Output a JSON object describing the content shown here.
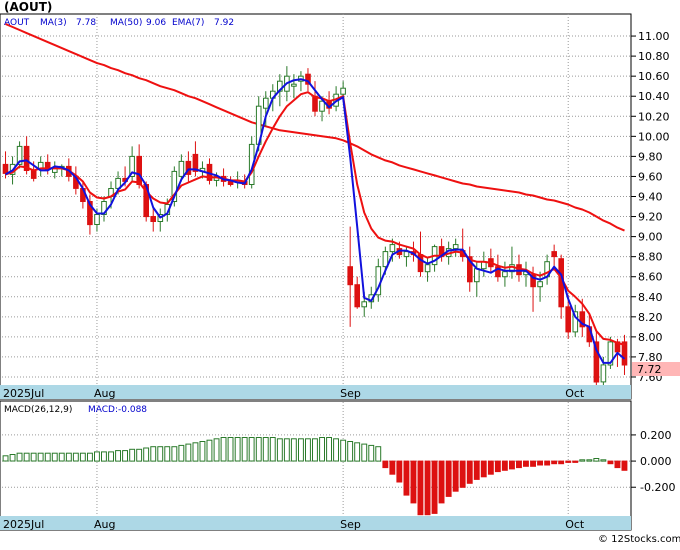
{
  "header": {
    "title": "(AOUT)"
  },
  "watermark": "© 12Stocks.com",
  "colors": {
    "up": "#2a7a2a",
    "down": "#dd1111",
    "ma3": "#1111dd",
    "ema": "#ee1111",
    "ma50": "#ee1111",
    "macd_pos": "#2a7a2a",
    "macd_neg": "#dd1111",
    "axis_band": "#add8e6",
    "price_tag": "#ffb6b6",
    "grid": "#9a9a9a"
  },
  "chart_data": [
    {
      "type": "candlestick",
      "legend": {
        "ticker": "AOUT",
        "ma3_label": "MA(3)",
        "ma3_value": "7.78",
        "ma50_label": "MA(50)",
        "ma50_value": "9.06",
        "ema7_label": "EMA(7)",
        "ema7_value": "7.92"
      },
      "last_price": "7.72",
      "x_tick_labels": [
        "2025Jul",
        "Aug",
        "Sep",
        "Oct"
      ],
      "y_tick_labels": [
        "11.00",
        "10.80",
        "10.60",
        "10.40",
        "10.20",
        "10.00",
        "9.80",
        "9.60",
        "9.40",
        "9.20",
        "9.00",
        "8.80",
        "8.60",
        "8.40",
        "8.20",
        "8.00",
        "7.80",
        "7.60"
      ],
      "ylim": [
        7.52,
        11.22
      ],
      "grid": true,
      "candles": [
        [
          9.72,
          9.85,
          9.58,
          9.63
        ],
        [
          9.62,
          9.8,
          9.52,
          9.72
        ],
        [
          9.72,
          9.95,
          9.68,
          9.9
        ],
        [
          9.9,
          10.0,
          9.62,
          9.66
        ],
        [
          9.66,
          9.75,
          9.55,
          9.58
        ],
        [
          9.68,
          9.8,
          9.6,
          9.74
        ],
        [
          9.74,
          9.82,
          9.62,
          9.67
        ],
        [
          9.64,
          9.75,
          9.58,
          9.68
        ],
        [
          9.68,
          9.72,
          9.6,
          9.7
        ],
        [
          9.7,
          9.78,
          9.55,
          9.6
        ],
        [
          9.6,
          9.7,
          9.42,
          9.48
        ],
        [
          9.48,
          9.55,
          9.28,
          9.35
        ],
        [
          9.35,
          9.42,
          9.02,
          9.12
        ],
        [
          9.12,
          9.28,
          9.05,
          9.22
        ],
        [
          9.22,
          9.4,
          9.15,
          9.35
        ],
        [
          9.4,
          9.55,
          9.28,
          9.48
        ],
        [
          9.48,
          9.65,
          9.42,
          9.58
        ],
        [
          9.58,
          9.7,
          9.5,
          9.55
        ],
        [
          9.6,
          9.9,
          9.55,
          9.8
        ],
        [
          9.8,
          9.92,
          9.48,
          9.52
        ],
        [
          9.52,
          9.55,
          9.15,
          9.2
        ],
        [
          9.2,
          9.28,
          9.05,
          9.15
        ],
        [
          9.15,
          9.28,
          9.05,
          9.22
        ],
        [
          9.22,
          9.38,
          9.15,
          9.32
        ],
        [
          9.35,
          9.7,
          9.3,
          9.65
        ],
        [
          9.6,
          9.82,
          9.55,
          9.75
        ],
        [
          9.75,
          9.85,
          9.55,
          9.62
        ],
        [
          9.82,
          9.95,
          9.6,
          9.65
        ],
        [
          9.65,
          9.75,
          9.58,
          9.68
        ],
        [
          9.72,
          9.78,
          9.52,
          9.56
        ],
        [
          9.56,
          9.64,
          9.5,
          9.6
        ],
        [
          9.6,
          9.68,
          9.5,
          9.55
        ],
        [
          9.55,
          9.6,
          9.5,
          9.52
        ],
        [
          9.54,
          9.65,
          9.48,
          9.56
        ],
        [
          9.55,
          9.62,
          9.48,
          9.52
        ],
        [
          9.52,
          10.0,
          9.48,
          9.92
        ],
        [
          9.92,
          10.4,
          9.85,
          10.3
        ],
        [
          10.28,
          10.45,
          10.1,
          10.38
        ],
        [
          10.38,
          10.52,
          10.25,
          10.45
        ],
        [
          10.45,
          10.62,
          10.3,
          10.55
        ],
        [
          10.45,
          10.7,
          10.35,
          10.6
        ],
        [
          10.5,
          10.62,
          10.38,
          10.52
        ],
        [
          10.55,
          10.65,
          10.45,
          10.6
        ],
        [
          10.62,
          10.68,
          10.45,
          10.52
        ],
        [
          10.4,
          10.55,
          10.2,
          10.25
        ],
        [
          10.25,
          10.4,
          10.15,
          10.35
        ],
        [
          10.35,
          10.45,
          10.22,
          10.28
        ],
        [
          10.3,
          10.5,
          10.25,
          10.42
        ],
        [
          10.42,
          10.55,
          10.35,
          10.48
        ],
        [
          8.7,
          9.1,
          8.1,
          8.52
        ],
        [
          8.52,
          8.6,
          8.28,
          8.3
        ],
        [
          8.3,
          8.45,
          8.2,
          8.35
        ],
        [
          8.35,
          8.5,
          8.28,
          8.42
        ],
        [
          8.42,
          8.78,
          8.35,
          8.7
        ],
        [
          8.7,
          8.9,
          8.62,
          8.85
        ],
        [
          8.85,
          8.98,
          8.75,
          8.92
        ],
        [
          8.88,
          8.95,
          8.78,
          8.82
        ],
        [
          8.8,
          8.9,
          8.7,
          8.85
        ],
        [
          8.85,
          8.95,
          8.75,
          8.82
        ],
        [
          8.82,
          9.05,
          8.6,
          8.65
        ],
        [
          8.65,
          8.8,
          8.55,
          8.72
        ],
        [
          8.72,
          8.92,
          8.65,
          8.9
        ],
        [
          8.9,
          8.98,
          8.75,
          8.8
        ],
        [
          8.8,
          8.95,
          8.72,
          8.88
        ],
        [
          8.88,
          8.98,
          8.8,
          8.92
        ],
        [
          8.86,
          9.08,
          8.75,
          8.8
        ],
        [
          8.8,
          8.9,
          8.45,
          8.55
        ],
        [
          8.55,
          8.75,
          8.4,
          8.68
        ],
        [
          8.68,
          8.85,
          8.6,
          8.75
        ],
        [
          8.78,
          8.88,
          8.65,
          8.7
        ],
        [
          8.7,
          8.82,
          8.55,
          8.6
        ],
        [
          8.6,
          8.75,
          8.5,
          8.65
        ],
        [
          8.65,
          8.9,
          8.58,
          8.72
        ],
        [
          8.72,
          8.82,
          8.55,
          8.62
        ],
        [
          8.62,
          8.75,
          8.5,
          8.65
        ],
        [
          8.62,
          8.7,
          8.25,
          8.5
        ],
        [
          8.5,
          8.65,
          8.35,
          8.55
        ],
        [
          8.6,
          8.82,
          8.52,
          8.75
        ],
        [
          8.85,
          8.92,
          8.7,
          8.8
        ],
        [
          8.78,
          8.82,
          8.18,
          8.3
        ],
        [
          8.3,
          8.42,
          7.98,
          8.05
        ],
        [
          8.05,
          8.32,
          8.0,
          8.25
        ],
        [
          8.25,
          8.38,
          8.0,
          8.1
        ],
        [
          8.1,
          8.22,
          7.9,
          7.95
        ],
        [
          7.95,
          8.05,
          7.52,
          7.55
        ],
        [
          7.55,
          7.8,
          7.52,
          7.72
        ],
        [
          7.72,
          8.0,
          7.68,
          7.95
        ],
        [
          7.95,
          7.98,
          7.7,
          7.85
        ],
        [
          7.95,
          8.02,
          7.62,
          7.72
        ]
      ],
      "ma3": [
        9.62,
        9.66,
        9.75,
        9.76,
        9.71,
        9.66,
        9.66,
        9.7,
        9.69,
        9.66,
        9.59,
        9.48,
        9.32,
        9.23,
        9.23,
        9.32,
        9.47,
        9.54,
        9.64,
        9.62,
        9.51,
        9.29,
        9.19,
        9.23,
        9.4,
        9.57,
        9.67,
        9.67,
        9.65,
        9.63,
        9.61,
        9.57,
        9.56,
        9.54,
        9.53,
        9.67,
        9.91,
        10.2,
        10.38,
        10.46,
        10.53,
        10.56,
        10.57,
        10.55,
        10.46,
        10.37,
        10.29,
        10.35,
        10.39,
        9.79,
        9.1,
        8.39,
        8.36,
        8.49,
        8.66,
        8.82,
        8.86,
        8.86,
        8.83,
        8.77,
        8.73,
        8.76,
        8.81,
        8.86,
        8.87,
        8.87,
        8.76,
        8.68,
        8.66,
        8.64,
        8.68,
        8.66,
        8.66,
        8.66,
        8.66,
        8.59,
        8.57,
        8.6,
        8.7,
        8.62,
        8.38,
        8.2,
        8.13,
        8.1,
        7.87,
        7.74,
        7.74,
        7.84,
        7.78
      ],
      "ema7": [
        9.62,
        9.64,
        9.7,
        9.69,
        9.66,
        9.68,
        9.68,
        9.68,
        9.68,
        9.66,
        9.61,
        9.55,
        9.44,
        9.39,
        9.38,
        9.4,
        9.45,
        9.47,
        9.55,
        9.54,
        9.45,
        9.38,
        9.34,
        9.33,
        9.42,
        9.51,
        9.54,
        9.57,
        9.6,
        9.59,
        9.59,
        9.58,
        9.56,
        9.56,
        9.55,
        9.64,
        9.8,
        9.95,
        10.08,
        10.2,
        10.3,
        10.36,
        10.42,
        10.44,
        10.39,
        10.38,
        10.35,
        10.37,
        10.4,
        9.93,
        9.52,
        9.24,
        9.08,
        8.99,
        8.96,
        8.95,
        8.92,
        8.9,
        8.88,
        8.82,
        8.79,
        8.81,
        8.81,
        8.83,
        8.85,
        8.84,
        8.77,
        8.75,
        8.75,
        8.74,
        8.71,
        8.69,
        8.7,
        8.68,
        8.67,
        8.63,
        8.61,
        8.64,
        8.68,
        8.59,
        8.46,
        8.4,
        8.33,
        8.23,
        8.06,
        7.98,
        7.97,
        7.94,
        7.92
      ],
      "ma50": [
        11.12,
        11.09,
        11.06,
        11.03,
        11.0,
        10.97,
        10.94,
        10.91,
        10.88,
        10.85,
        10.82,
        10.79,
        10.76,
        10.73,
        10.71,
        10.68,
        10.66,
        10.63,
        10.61,
        10.58,
        10.56,
        10.53,
        10.5,
        10.48,
        10.46,
        10.43,
        10.4,
        10.38,
        10.35,
        10.32,
        10.29,
        10.26,
        10.23,
        10.2,
        10.17,
        10.14,
        10.12,
        10.1,
        10.08,
        10.06,
        10.05,
        10.04,
        10.03,
        10.02,
        10.01,
        10.0,
        9.99,
        9.98,
        9.96,
        9.93,
        9.9,
        9.86,
        9.82,
        9.79,
        9.76,
        9.74,
        9.71,
        9.69,
        9.67,
        9.65,
        9.63,
        9.61,
        9.59,
        9.57,
        9.55,
        9.53,
        9.52,
        9.5,
        9.49,
        9.48,
        9.47,
        9.46,
        9.45,
        9.44,
        9.42,
        9.41,
        9.39,
        9.37,
        9.36,
        9.34,
        9.32,
        9.29,
        9.27,
        9.24,
        9.2,
        9.16,
        9.13,
        9.09,
        9.06
      ]
    },
    {
      "type": "bar",
      "legend": {
        "label": "MACD(26,12,9)",
        "value_label": "MACD:-0.088"
      },
      "y_tick_labels": [
        "0.200",
        "0.000",
        "-0.200"
      ],
      "ylim": [
        -0.42,
        0.36
      ],
      "values": [
        0.04,
        0.05,
        0.06,
        0.06,
        0.06,
        0.06,
        0.06,
        0.06,
        0.06,
        0.06,
        0.06,
        0.06,
        0.06,
        0.07,
        0.07,
        0.07,
        0.08,
        0.08,
        0.09,
        0.09,
        0.1,
        0.11,
        0.11,
        0.11,
        0.11,
        0.12,
        0.13,
        0.14,
        0.15,
        0.16,
        0.17,
        0.18,
        0.18,
        0.18,
        0.18,
        0.18,
        0.18,
        0.18,
        0.18,
        0.17,
        0.17,
        0.17,
        0.17,
        0.17,
        0.17,
        0.18,
        0.18,
        0.17,
        0.16,
        0.15,
        0.14,
        0.13,
        0.12,
        0.11,
        -0.05,
        -0.1,
        -0.16,
        -0.26,
        -0.32,
        -0.41,
        -0.41,
        -0.4,
        -0.32,
        -0.27,
        -0.23,
        -0.2,
        -0.17,
        -0.14,
        -0.12,
        -0.1,
        -0.08,
        -0.07,
        -0.06,
        -0.05,
        -0.04,
        -0.04,
        -0.03,
        -0.03,
        -0.02,
        -0.02,
        -0.01,
        -0.01,
        0.01,
        0.01,
        0.02,
        0.01,
        -0.02,
        -0.05,
        -0.07
      ]
    }
  ]
}
